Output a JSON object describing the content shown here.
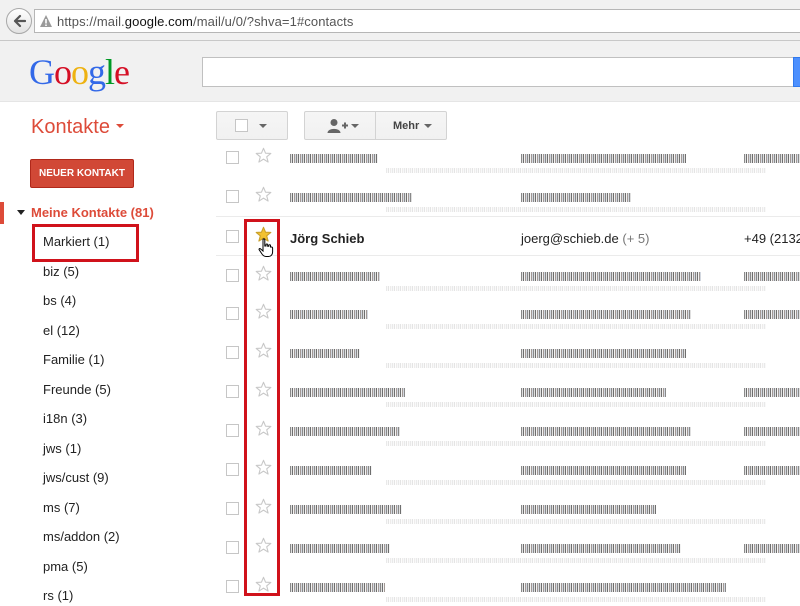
{
  "browser": {
    "url_prefix": "https://mail.",
    "url_domain": "google.com",
    "url_suffix": "/mail/u/0/?shva=1#contacts"
  },
  "header": {
    "logo_letters": [
      "G",
      "o",
      "o",
      "g",
      "l",
      "e"
    ]
  },
  "app": {
    "title": "Kontakte",
    "more_label": "Mehr",
    "new_contact_label": "NEUER KONTAKT"
  },
  "sidebar": {
    "my_contacts_label": "Meine Kontakte (81)",
    "groups": [
      "Markiert (1)",
      "biz (5)",
      "bs (4)",
      "el (12)",
      "Familie (1)",
      "Freunde (5)",
      "i18n (3)",
      "jws (1)",
      "jws/cust (9)",
      "ms (7)",
      "ms/addon (2)",
      "pma (5)",
      "rs (1)"
    ]
  },
  "contacts": {
    "starred_row": {
      "name": "Jörg Schieb",
      "email": "joerg@schieb.de",
      "email_extra": "(+ 5)",
      "phone": "+49 (2132"
    }
  },
  "icons": {
    "star_filled_color": "#f2c230",
    "star_empty_color": "#c8c8c8",
    "highlight_box_color": "#d0121b",
    "accent_color": "#dd4b39"
  }
}
